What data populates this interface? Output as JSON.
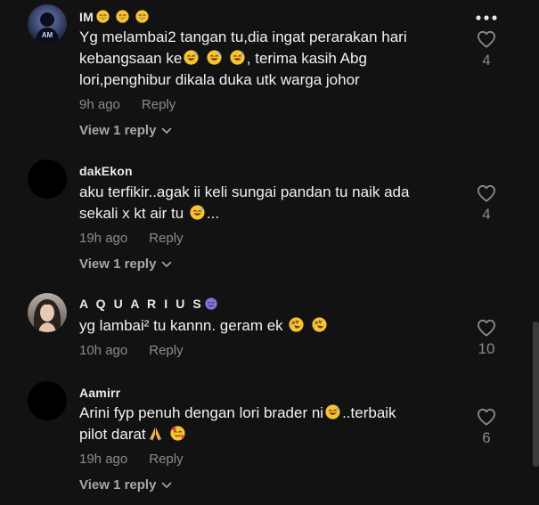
{
  "colors": {
    "background": "#121212",
    "text": "#f1f1f2",
    "muted": "#8a8b91",
    "emoji_yellow": "#f7c331"
  },
  "comments": [
    {
      "username": "IM",
      "username_emoji": [
        "grin-face-icon",
        "grin-face-icon",
        "grin-face-icon"
      ],
      "text_lines": [
        "Yg melambai2 tangan tu,dia ingat perarakan hari",
        "kebangsaan ke",
        ", terima kasih Abg",
        "lori,penghibur dikala duka utk warga johor"
      ],
      "time": "9h ago",
      "reply_label": "Reply",
      "view_replies": "View 1 reply",
      "likes": "4",
      "avatar_text": "AM"
    },
    {
      "username": "dakEkon",
      "text_lines": [
        "aku terfikir..agak ii keli sungai pandan tu naik ada",
        "sekali x kt air tu",
        "..."
      ],
      "time": "19h ago",
      "reply_label": "Reply",
      "view_replies": "View 1 reply",
      "likes": "4"
    },
    {
      "username": "A Q U A R I U S",
      "text_lines": [
        "yg lambai² tu kannn. geram ek"
      ],
      "time": "10h ago",
      "reply_label": "Reply",
      "likes": "10"
    },
    {
      "username": "Aamirr",
      "text_lines": [
        "Arini fyp penuh dengan lori brader ni",
        "..terbaik",
        "pilot darat"
      ],
      "time": "19h ago",
      "reply_label": "Reply",
      "view_replies": "View 1 reply",
      "likes": "6"
    }
  ]
}
